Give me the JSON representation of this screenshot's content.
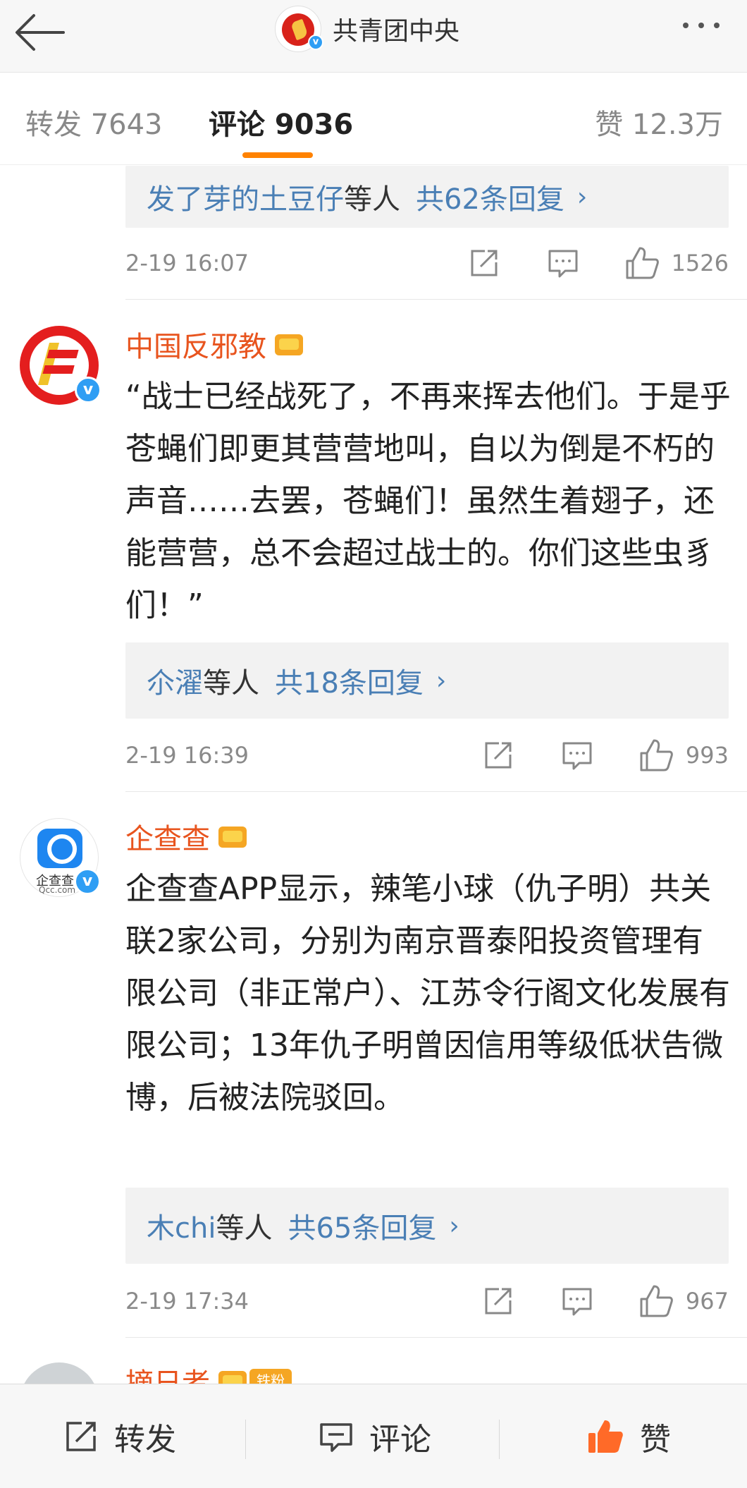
{
  "nav": {
    "title": "共青团中央",
    "back_icon": "arrow-left-icon",
    "more_icon": "more-dots-icon"
  },
  "tabs": {
    "repost": "转发 7643",
    "comment": "评论 9036",
    "like": "赞 12.3万",
    "active_color": "#ff8200"
  },
  "comments": [
    {
      "reply_names": "发了芽的土豆仔",
      "reply_suffix": "等人",
      "reply_count": "共62条回复",
      "time": "2-19 16:07",
      "likes": "1526"
    },
    {
      "username": "中国反邪教",
      "content": "“战士已经战死了，不再来挥去他们。于是乎苍蝇们即更其营营地叫，自以为倒是不朽的声音……去罢，苍蝇们！虽然生着翅子，还能营营，总不会超过战士的。你们这些虫豸们！”",
      "reply_names": "尒濯",
      "reply_suffix": "等人",
      "reply_count": "共18条回复",
      "time": "2-19 16:39",
      "likes": "993"
    },
    {
      "username": "企查查",
      "avatar_text": "企查查",
      "avatar_sub": "Qcc.com",
      "content": "企查查APP显示，辣笔小球（仇子明）共关联2家公司，分别为南京晋泰阳投资管理有限公司（非正常户）、江苏令行阁文化发展有限公司；13年仇子明曾因信用等级低状告微博，后被法院驳回。",
      "reply_names": "木chi",
      "reply_suffix": "等人",
      "reply_count": "共65条回复",
      "time": "2-19 17:34",
      "likes": "967"
    },
    {
      "username": "摘日者",
      "badge": "铁粉"
    }
  ],
  "bottom": {
    "repost": "转发",
    "comment": "评论",
    "like": "赞"
  },
  "colors": {
    "username": "#e8541e",
    "link": "#4a7fb5",
    "like_active": "#ff6a28",
    "verified": "#2f9ef4"
  }
}
